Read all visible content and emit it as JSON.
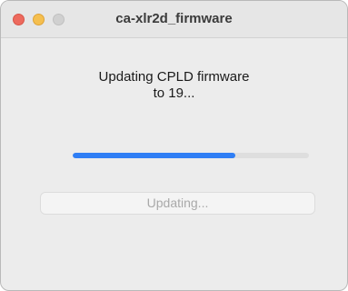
{
  "window": {
    "title": "ca-xlr2d_firmware"
  },
  "dialog": {
    "message_line1": "Updating CPLD firmware",
    "message_line2": "to 19...",
    "progress_fraction": 0.69,
    "button_label": "Updating..."
  },
  "colors": {
    "progress_fill": "#2f7ef5",
    "progress_track": "#dedede",
    "close_button": "#ed6a5e",
    "minimize_button": "#f5bf4f",
    "zoom_button_disabled": "#d0d0d0"
  }
}
